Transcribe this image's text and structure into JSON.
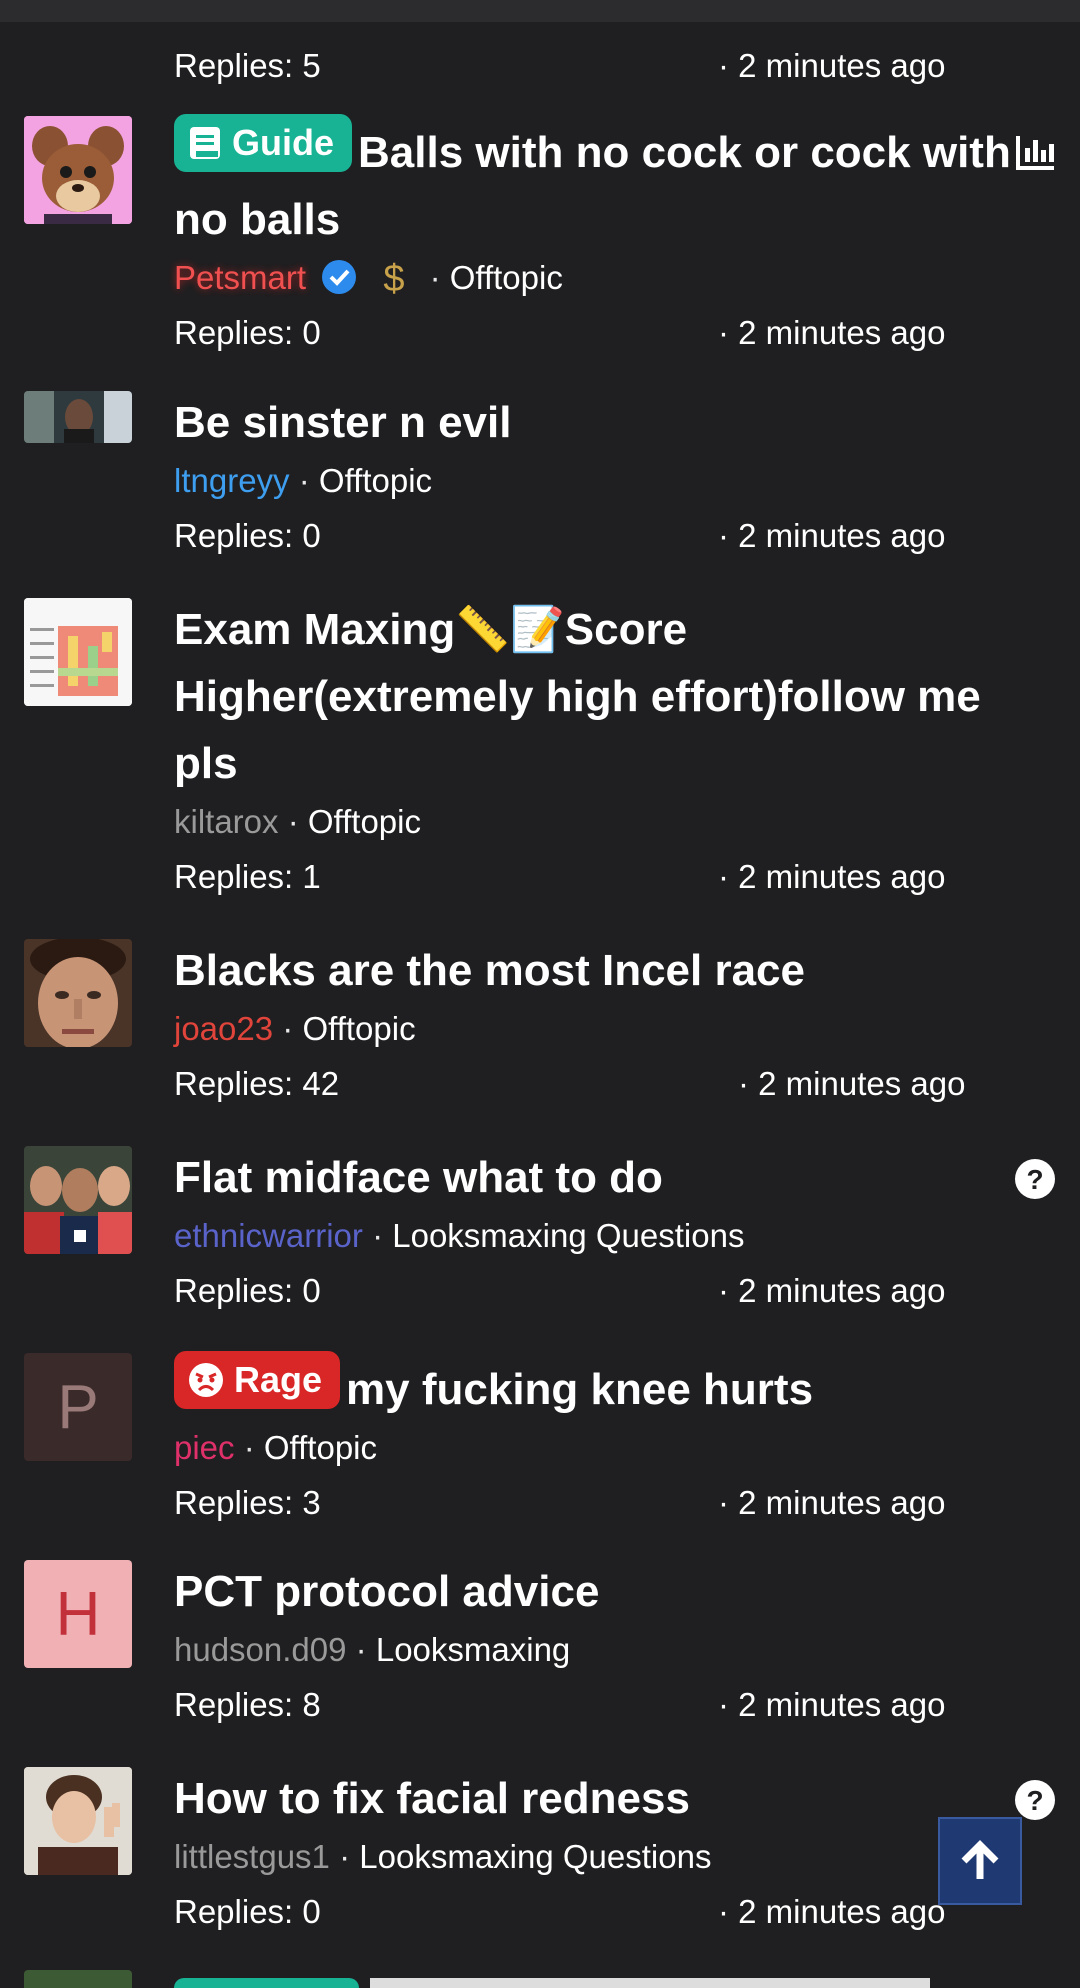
{
  "top_row": {
    "replies": "Replies: 5",
    "time": "· 2 minutes ago"
  },
  "threads": [
    {
      "badge": "Guide",
      "title": "Balls with no cock or cock with no balls",
      "author": "Petsmart",
      "author_color": "#f0504f",
      "verified": true,
      "dollar_icon": "$",
      "forum": "Offtopic",
      "replies": "Replies: 0",
      "time": "· 2 minutes ago",
      "right_icon": "poll-chart-icon"
    },
    {
      "title": "Be sinster n evil",
      "author": "ltngreyy",
      "author_color": "#3e9ef0",
      "forum": "Offtopic",
      "replies": "Replies: 0",
      "time": "· 2 minutes ago"
    },
    {
      "title": "Exam Maxing📏📝Score Higher(extremely high effort)follow me pls",
      "author": "kiltarox",
      "author_color": "#9a9a9a",
      "forum": "Offtopic",
      "replies": "Replies: 1",
      "time": "· 2 minutes ago"
    },
    {
      "title": "Blacks are the most Incel race",
      "author": "joao23",
      "author_color": "#e0443a",
      "forum": "Offtopic",
      "replies": "Replies: 42",
      "time": "· 2 minutes ago"
    },
    {
      "title": "Flat midface what to do",
      "author": "ethnicwarrior",
      "author_color": "#5a63c9",
      "forum": "Looksmaxing Questions",
      "replies": "Replies: 0",
      "time": "· 2 minutes ago",
      "right_icon": "question-icon"
    },
    {
      "badge": "Rage",
      "title": "my fucking knee hurts",
      "author": "piec",
      "author_color": "#e0306a",
      "avatar_letter": "P",
      "forum": "Offtopic",
      "replies": "Replies: 3",
      "time": "· 2 minutes ago"
    },
    {
      "title": "PCT protocol advice",
      "author": "hudson.d09",
      "author_color": "#9a9a9a",
      "avatar_letter": "H",
      "forum": "Looksmaxing",
      "replies": "Replies: 8",
      "time": "· 2 minutes ago"
    },
    {
      "title": "How to fix facial redness",
      "author": "littlestgus1",
      "author_color": "#9a9a9a",
      "forum": "Looksmaxing Questions",
      "replies": "Replies: 0",
      "time": "· 2 minutes ago",
      "right_icon": "question-icon"
    }
  ],
  "separator": "·",
  "scroll_top_icon": "arrow-up-icon"
}
